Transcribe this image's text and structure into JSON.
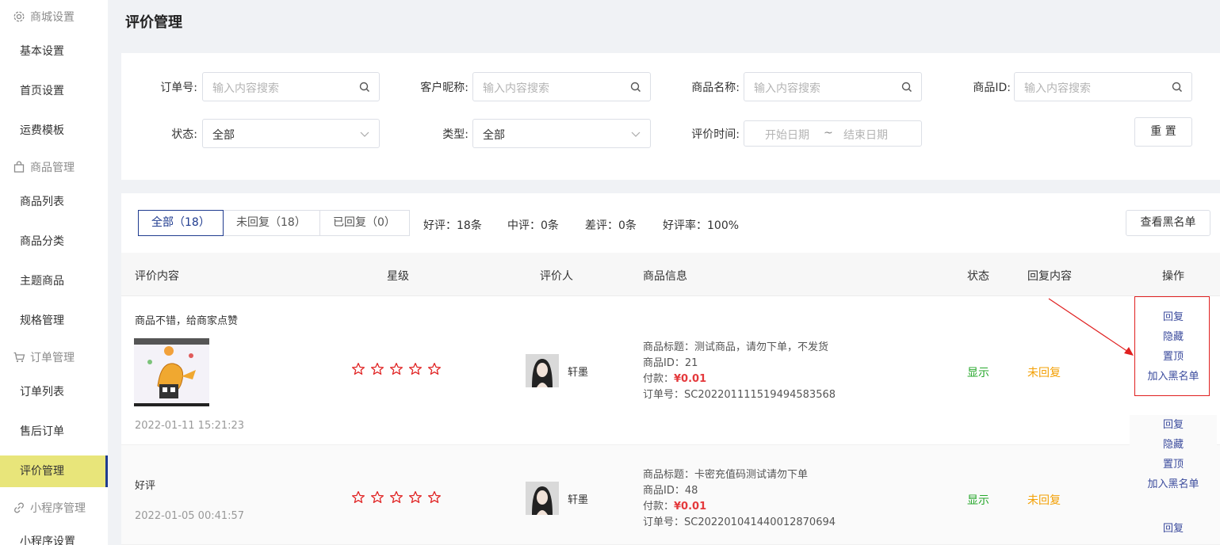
{
  "sidebar": {
    "groups": [
      {
        "label": "商城设置",
        "icon": "gear-icon"
      },
      {
        "label": "商品管理",
        "icon": "bag-icon"
      },
      {
        "label": "订单管理",
        "icon": "cart-icon"
      },
      {
        "label": "小程序管理",
        "icon": "link-icon"
      }
    ],
    "items": [
      "基本设置",
      "首页设置",
      "运费模板",
      "商品列表",
      "商品分类",
      "主题商品",
      "规格管理",
      "订单列表",
      "售后订单",
      "评价管理",
      "小程序设置"
    ],
    "active_item": "评价管理",
    "active_color": "#e8e57a"
  },
  "page": {
    "title": "评价管理"
  },
  "filters": {
    "order_no": {
      "label": "订单号:",
      "placeholder": "输入内容搜索"
    },
    "nickname": {
      "label": "客户昵称:",
      "placeholder": "输入内容搜索"
    },
    "product_name": {
      "label": "商品名称:",
      "placeholder": "输入内容搜索"
    },
    "product_id": {
      "label": "商品ID:",
      "placeholder": "输入内容搜索"
    },
    "status": {
      "label": "状态:",
      "value": "全部"
    },
    "type": {
      "label": "类型:",
      "value": "全部"
    },
    "time": {
      "label": "评价时间:",
      "start": "开始日期",
      "sep": "~",
      "end": "结束日期"
    },
    "reset_label": "重 置"
  },
  "tabs": [
    {
      "label": "全部（18）",
      "active": true
    },
    {
      "label": "未回复（18）",
      "active": false
    },
    {
      "label": "已回复（0）",
      "active": false
    }
  ],
  "stats": {
    "good": "好评：18条",
    "mid": "中评：0条",
    "bad": "差评：0条",
    "rate": "好评率：100%"
  },
  "blacklist_button": "查看黑名单",
  "table": {
    "headers": [
      "评价内容",
      "星级",
      "评价人",
      "商品信息",
      "状态",
      "回复内容",
      "操作"
    ],
    "rows": [
      {
        "content": "商品不错，给商家点赞",
        "date": "2022-01-11 15:21:23",
        "stars": 5,
        "reviewer": "轩墨",
        "product_title": "商品标题：测试商品，请勿下单，不发货",
        "product_id": "商品ID：21",
        "pay_label": "付款：",
        "pay_value": "¥0.01",
        "order_no": "订单号：SC20220111151949458356​8",
        "status": "显示",
        "reply": "未回复",
        "ops": [
          "回复",
          "隐藏",
          "置顶",
          "加入黑名单"
        ]
      },
      {
        "content": "好评",
        "date": "2022-01-05 00:41:57",
        "stars": 5,
        "reviewer": "轩墨",
        "product_title": "商品标题：卡密充值码测试请勿下单",
        "product_id": "商品ID：48",
        "pay_label": "付款：",
        "pay_value": "¥0.01",
        "order_no": "订单号：SC202201041440012870694",
        "status": "显示",
        "reply": "未回复",
        "ops": [
          "回复",
          "隐藏",
          "置顶",
          "加入黑名单"
        ]
      }
    ],
    "next_row_op": "回复"
  },
  "colors": {
    "accent": "#1f3b8f",
    "status_show": "#25a72a",
    "status_unreplied": "#f3a005",
    "price": "#e4393c",
    "star": "#e02020",
    "highlight": "#e02020"
  }
}
